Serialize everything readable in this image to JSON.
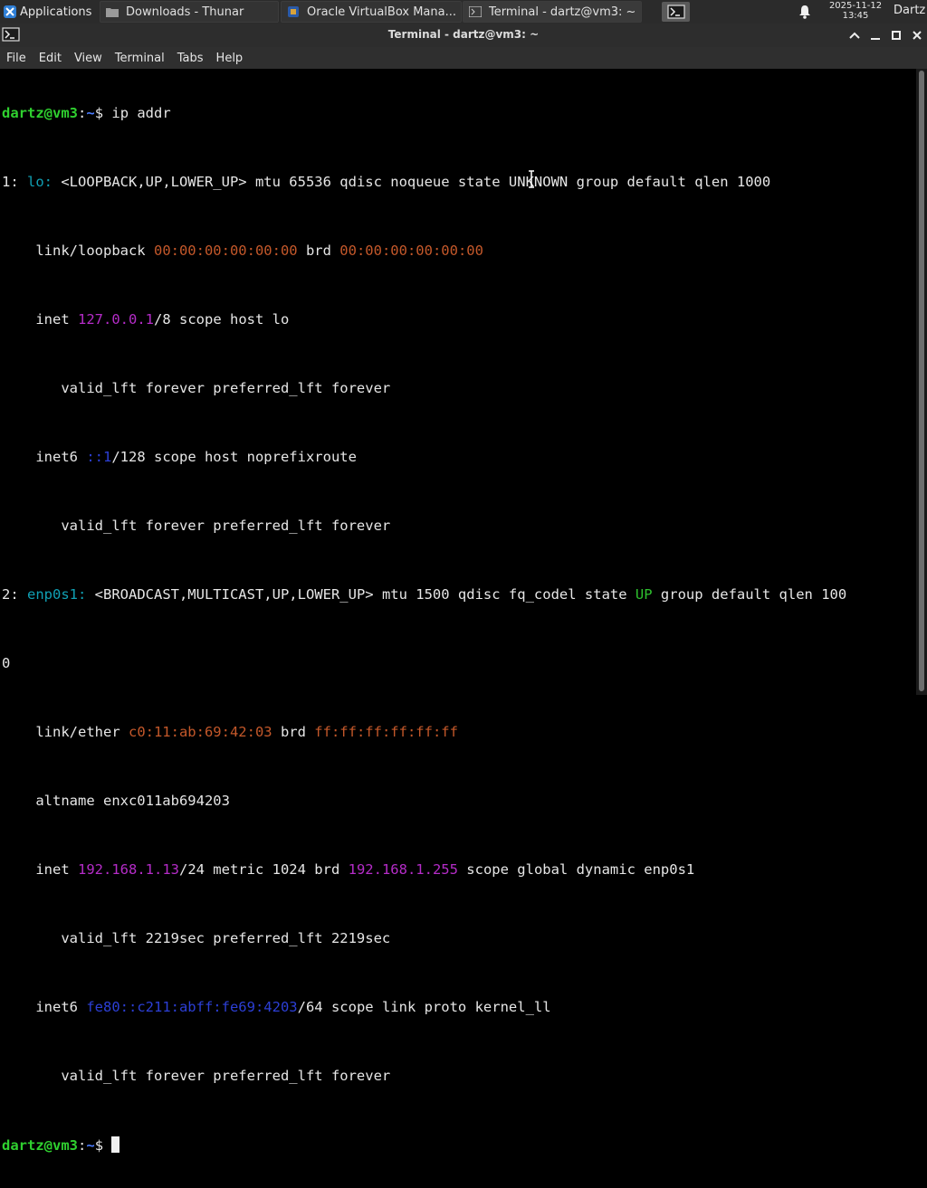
{
  "panel": {
    "applications": "Applications",
    "tasks": [
      {
        "label": "Downloads - Thunar",
        "icon": "folder-icon"
      },
      {
        "label": "Oracle VirtualBox Mana...",
        "icon": "virtualbox-icon"
      },
      {
        "label": "Terminal - dartz@vm3: ~",
        "icon": "terminal-icon"
      }
    ],
    "clock_date": "2025-11-12",
    "clock_time": "13:45",
    "user": "Dartz"
  },
  "window": {
    "title": "Terminal - dartz@vm3: ~"
  },
  "menu": [
    "File",
    "Edit",
    "View",
    "Terminal",
    "Tabs",
    "Help"
  ],
  "terminal": {
    "prompt_user": "dartz@vm3",
    "prompt_path": "~",
    "prompt_sep": ":",
    "prompt_end": "$ ",
    "command": "ip addr",
    "l1_a": "1: ",
    "l1_if": "lo:",
    "l1_b": " <LOOPBACK,UP,LOWER_UP> mtu 65536 qdisc noqueue state UNKNOWN group default qlen 1000",
    "l2_a": "    link/loopback ",
    "l2_mac1": "00:00:00:00:00:00",
    "l2_b": " brd ",
    "l2_mac2": "00:00:00:00:00:00",
    "l3_a": "    inet ",
    "l3_ip": "127.0.0.1",
    "l3_b": "/8 scope host lo",
    "l4": "       valid_lft forever preferred_lft forever",
    "l5_a": "    inet6 ",
    "l5_ip": "::1",
    "l5_b": "/128 scope host noprefixroute",
    "l6": "       valid_lft forever preferred_lft forever",
    "l7_a": "2: ",
    "l7_if": "enp0s1:",
    "l7_b": " <BROADCAST,MULTICAST,UP,LOWER_UP> mtu 1500 qdisc fq_codel state ",
    "l7_up": "UP",
    "l7_c": " group default qlen 100",
    "l8": "0",
    "l9_a": "    link/ether ",
    "l9_mac1": "c0:11:ab:69:42:03",
    "l9_b": " brd ",
    "l9_mac2": "ff:ff:ff:ff:ff:ff",
    "l10": "    altname enxc011ab694203",
    "l11_a": "    inet ",
    "l11_ip": "192.168.1.13",
    "l11_b": "/24 metric 1024 brd ",
    "l11_brd": "192.168.1.255",
    "l11_c": " scope global dynamic enp0s1",
    "l12": "       valid_lft 2219sec preferred_lft 2219sec",
    "l13_a": "    inet6 ",
    "l13_ip": "fe80::c211:abff:fe69:4203",
    "l13_b": "/64 scope link proto kernel_ll",
    "l14": "       valid_lft forever preferred_lft forever"
  }
}
